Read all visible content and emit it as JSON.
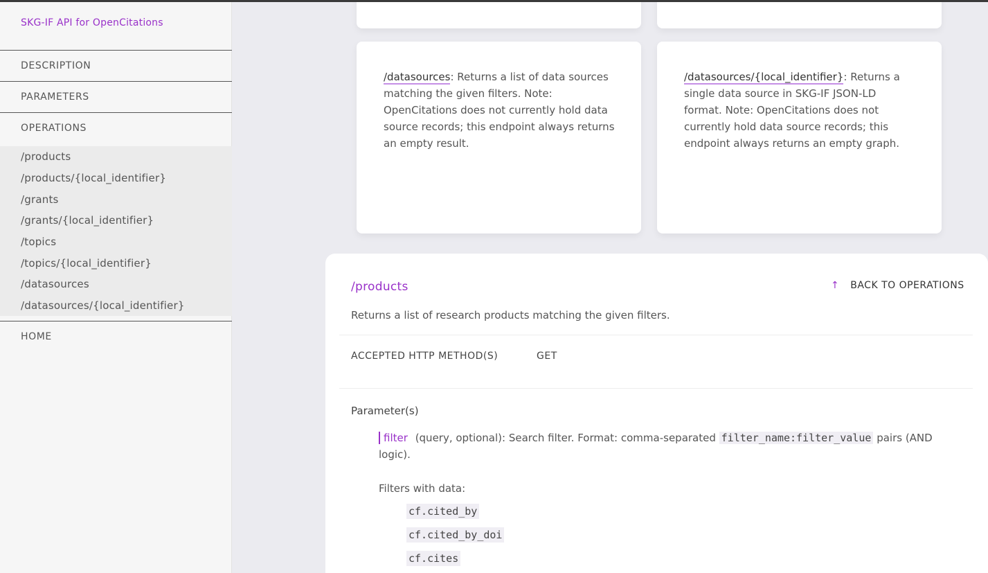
{
  "sidebar": {
    "brand": "SKG-IF API for OpenCitations",
    "nav": {
      "description": "DESCRIPTION",
      "parameters": "PARAMETERS",
      "operations": "OPERATIONS",
      "home": "HOME"
    },
    "operations": [
      "/products",
      "/products/{local_identifier}",
      "/grants",
      "/grants/{local_identifier}",
      "/topics",
      "/topics/{local_identifier}",
      "/datasources",
      "/datasources/{local_identifier}"
    ]
  },
  "cards": [
    {
      "endpoint": "/datasources",
      "text": ": Returns a list of data sources matching the given filters. Note: OpenCitations does not currently hold data source records; this endpoint always returns an empty result."
    },
    {
      "endpoint": "/datasources/{local_identifier}",
      "text": ": Returns a single data source in SKG-IF JSON-LD format. Note: OpenCitations does not currently hold data source records; this endpoint always returns an empty graph."
    }
  ],
  "operation": {
    "title": "/products",
    "back_label": "BACK TO OPERATIONS",
    "back_icon": "↑",
    "description": "Returns a list of research products matching the given filters.",
    "methods_label": "ACCEPTED HTTP METHOD(S)",
    "methods_value": "GET",
    "params_title": "Parameter(s)",
    "param": {
      "name": "filter",
      "desc_prefix": "(query, optional): Search filter. Format: comma-separated",
      "code": "filter_name:filter_value",
      "desc_suffix": "pairs (AND logic)."
    },
    "filters_title": "Filters with data:",
    "filters": [
      "cf.cited_by",
      "cf.cited_by_doi",
      "cf.cites"
    ]
  },
  "colors": {
    "accent": "#9931c9",
    "underline": "#c58fe6",
    "background": "#ebebf0"
  }
}
